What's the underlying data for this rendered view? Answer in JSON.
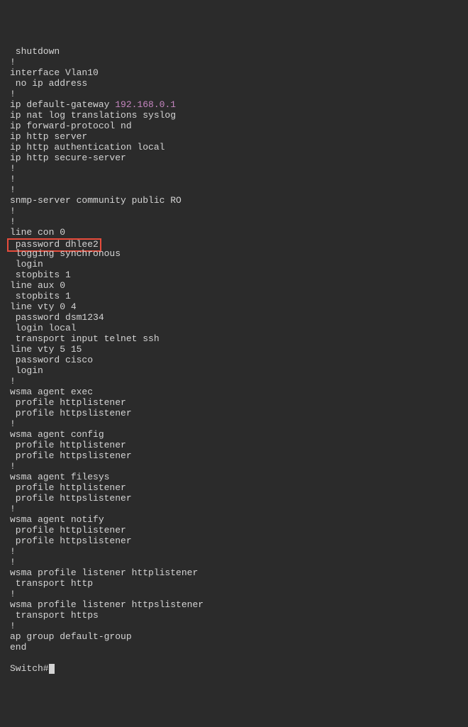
{
  "terminal": {
    "lines": [
      {
        "indent": 1,
        "text": "shutdown"
      },
      {
        "indent": 0,
        "text": "!"
      },
      {
        "indent": 0,
        "text": "interface Vlan10"
      },
      {
        "indent": 1,
        "text": "no ip address"
      },
      {
        "indent": 0,
        "text": "!"
      },
      {
        "indent": 0,
        "text": "ip default-gateway ",
        "ip": "192.168.0.1"
      },
      {
        "indent": 0,
        "text": "ip nat log translations syslog"
      },
      {
        "indent": 0,
        "text": "ip forward-protocol nd"
      },
      {
        "indent": 0,
        "text": "ip http server"
      },
      {
        "indent": 0,
        "text": "ip http authentication local"
      },
      {
        "indent": 0,
        "text": "ip http secure-server"
      },
      {
        "indent": 0,
        "text": "!"
      },
      {
        "indent": 0,
        "text": "!"
      },
      {
        "indent": 0,
        "text": "!"
      },
      {
        "indent": 0,
        "text": "snmp-server community public RO"
      },
      {
        "indent": 0,
        "text": "!"
      },
      {
        "indent": 0,
        "text": "!"
      },
      {
        "indent": 0,
        "text": "line con 0"
      },
      {
        "indent": 1,
        "highlight": true,
        "text": "password dhlee2"
      },
      {
        "indent": 1,
        "text": "logging synchronous"
      },
      {
        "indent": 1,
        "text": "login"
      },
      {
        "indent": 1,
        "text": "stopbits 1"
      },
      {
        "indent": 0,
        "text": "line aux 0"
      },
      {
        "indent": 1,
        "text": "stopbits 1"
      },
      {
        "indent": 0,
        "text": "line vty 0 4"
      },
      {
        "indent": 1,
        "text": "password dsm1234"
      },
      {
        "indent": 1,
        "text": "login local"
      },
      {
        "indent": 1,
        "text": "transport input telnet ssh"
      },
      {
        "indent": 0,
        "text": "line vty 5 15"
      },
      {
        "indent": 1,
        "text": "password cisco"
      },
      {
        "indent": 1,
        "text": "login"
      },
      {
        "indent": 0,
        "text": "!"
      },
      {
        "indent": 0,
        "text": "wsma agent exec"
      },
      {
        "indent": 1,
        "text": "profile httplistener"
      },
      {
        "indent": 1,
        "text": "profile httpslistener"
      },
      {
        "indent": 0,
        "text": "!"
      },
      {
        "indent": 0,
        "text": "wsma agent config"
      },
      {
        "indent": 1,
        "text": "profile httplistener"
      },
      {
        "indent": 1,
        "text": "profile httpslistener"
      },
      {
        "indent": 0,
        "text": "!"
      },
      {
        "indent": 0,
        "text": "wsma agent filesys"
      },
      {
        "indent": 1,
        "text": "profile httplistener"
      },
      {
        "indent": 1,
        "text": "profile httpslistener"
      },
      {
        "indent": 0,
        "text": "!"
      },
      {
        "indent": 0,
        "text": "wsma agent notify"
      },
      {
        "indent": 1,
        "text": "profile httplistener"
      },
      {
        "indent": 1,
        "text": "profile httpslistener"
      },
      {
        "indent": 0,
        "text": "!"
      },
      {
        "indent": 0,
        "text": "!"
      },
      {
        "indent": 0,
        "text": "wsma profile listener httplistener"
      },
      {
        "indent": 1,
        "text": "transport http"
      },
      {
        "indent": 0,
        "text": "!"
      },
      {
        "indent": 0,
        "text": "wsma profile listener httpslistener"
      },
      {
        "indent": 1,
        "text": "transport https"
      },
      {
        "indent": 0,
        "text": "!"
      },
      {
        "indent": 0,
        "text": "ap group default-group"
      },
      {
        "indent": 0,
        "text": "end"
      },
      {
        "indent": 0,
        "text": ""
      },
      {
        "indent": 0,
        "prompt": true,
        "text": "Switch#"
      }
    ]
  }
}
